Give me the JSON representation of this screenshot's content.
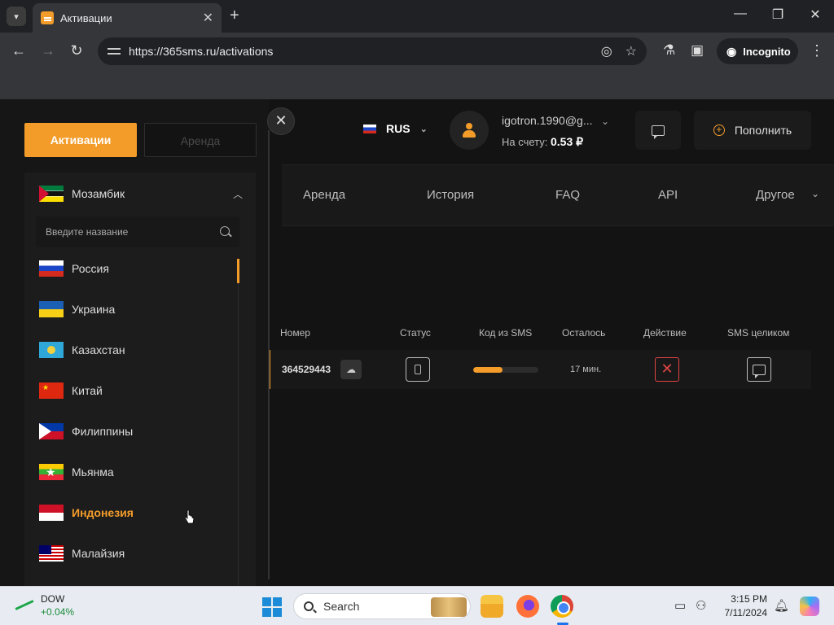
{
  "browser": {
    "tab_title": "Активации",
    "url": "https://365sms.ru/activations",
    "incognito_label": "Incognito"
  },
  "header": {
    "language": "RUS",
    "user_email": "igotron.1990@g...",
    "balance_label": "На счету:",
    "balance_value": "0.53 ₽",
    "topup_label": "Пополнить"
  },
  "nav": {
    "items": [
      {
        "label": "Аренда"
      },
      {
        "label": "История"
      },
      {
        "label": "FAQ"
      },
      {
        "label": "API"
      },
      {
        "label": "Другое"
      }
    ]
  },
  "table": {
    "columns": [
      "Номер",
      "Статус",
      "Код из SMS",
      "Осталось",
      "Действие",
      "SMS целиком"
    ],
    "rows": [
      {
        "number": "364529443",
        "progress": 0.45,
        "remaining": "17 мин."
      }
    ]
  },
  "panel": {
    "tab_activations": "Активации",
    "tab_rent": "Аренда",
    "selected_country": "Мозамбик",
    "search_placeholder": "Введите название",
    "countries": [
      {
        "name": "Россия",
        "flag": "ru"
      },
      {
        "name": "Украина",
        "flag": "ua"
      },
      {
        "name": "Казахстан",
        "flag": "kz"
      },
      {
        "name": "Китай",
        "flag": "cn"
      },
      {
        "name": "Филиппины",
        "flag": "ph"
      },
      {
        "name": "Мьянма",
        "flag": "mm"
      },
      {
        "name": "Индонезия",
        "flag": "id",
        "active": true
      },
      {
        "name": "Малайзия",
        "flag": "my"
      }
    ]
  },
  "taskbar": {
    "stock_name": "DOW",
    "stock_change": "+0.04%",
    "search_label": "Search",
    "time": "3:15 PM",
    "date": "7/11/2024"
  },
  "colors": {
    "accent": "#f39c2a",
    "danger": "#e04444",
    "background": "#131313"
  }
}
